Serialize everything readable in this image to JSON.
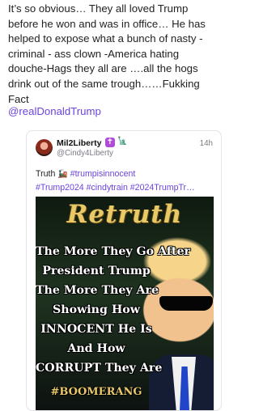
{
  "post": {
    "text": "It’s so obvious… They all loved Trump\nbefore he won and was in office… He has\nhelped to expose what a bunch of nasty -\ncriminal - ass clown -America hating\ndouche-Hags they all are ….all the hogs\ndrink out of the same trough……Fukking\nFact",
    "mention": "@realDonaldTrump"
  },
  "quoted": {
    "display_name": "Mil2Liberty",
    "handle": "@Cindy4Liberty",
    "time": "14h",
    "text_prefix": "Truth",
    "tag_1": "#trumpisinnocent",
    "line_2": "#Trump2024 #cindytrain #2024TrumpTr…",
    "meme": {
      "title": "Retruth",
      "lines": [
        "The More They Go After",
        "President Trump",
        "The  More They Are",
        "Showing How",
        "INNOCENT He Is",
        "And How",
        "CORRUPT They Are"
      ],
      "hashtag": "#BOOMERANG"
    }
  },
  "icons": {
    "badge_cross": "cross-badge-icon",
    "badge_liberty": "statue-of-liberty-icon",
    "train": "train-emoji-icon"
  },
  "colors": {
    "link": "#6a43e0",
    "muted": "#7a7a85",
    "meme_gold": "#e8c968"
  }
}
